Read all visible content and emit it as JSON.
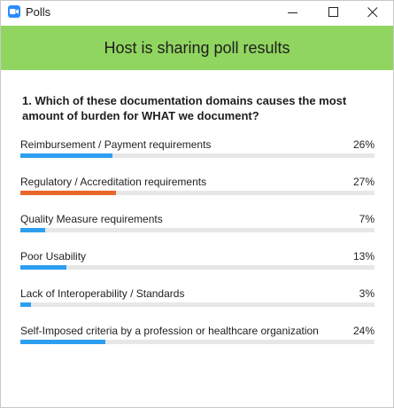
{
  "window": {
    "title": "Polls"
  },
  "banner": {
    "text": "Host is sharing poll results"
  },
  "question": {
    "text": "1. Which of these documentation domains causes the most amount of burden for WHAT we document?"
  },
  "colors": {
    "banner": "#90d55f",
    "bar": "#2d9ff0",
    "bar_highlight": "#e8682c",
    "track": "#e7e7e7"
  },
  "options": [
    {
      "label": "Reimbursement / Payment requirements",
      "pct_text": "26%",
      "value": 26,
      "highlight": false
    },
    {
      "label": "Regulatory / Accreditation requirements",
      "pct_text": "27%",
      "value": 27,
      "highlight": true
    },
    {
      "label": "Quality Measure requirements",
      "pct_text": "7%",
      "value": 7,
      "highlight": false
    },
    {
      "label": "Poor Usability",
      "pct_text": "13%",
      "value": 13,
      "highlight": false
    },
    {
      "label": "Lack of Interoperability / Standards",
      "pct_text": "3%",
      "value": 3,
      "highlight": false
    },
    {
      "label": "Self-Imposed criteria by a profession or healthcare organization",
      "pct_text": "24%",
      "value": 24,
      "highlight": false
    }
  ]
}
